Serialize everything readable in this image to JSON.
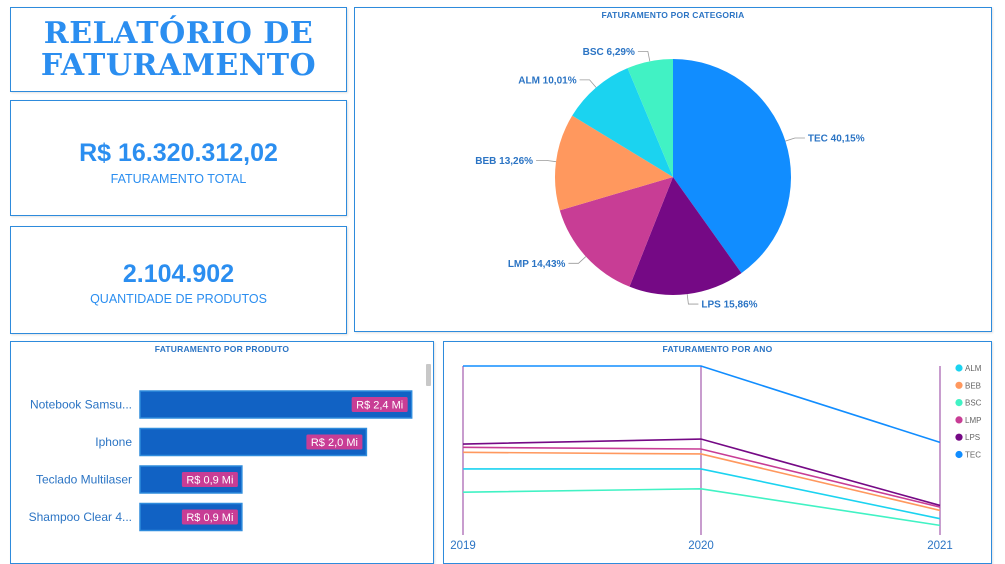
{
  "report": {
    "title_line1": "RELATÓRIO DE",
    "title_line2": "FATURAMENTO"
  },
  "kpis": {
    "revenue": {
      "value": "R$ 16.320.312,02",
      "label": "FATURAMENTO TOTAL"
    },
    "quantity": {
      "value": "2.104.902",
      "label": "QUANTIDADE DE PRODUTOS"
    }
  },
  "colors": {
    "TEC": "#118dff",
    "LPS": "#750985",
    "LMP": "#c83d95",
    "BEB": "#ff985e",
    "ALM": "#1bd3f0",
    "BSC": "#41f2c4",
    "bar": "#1162c4",
    "bar_label_bg": "#c83d95",
    "accent": "#2b8ef0"
  },
  "chart_data": [
    {
      "type": "pie",
      "title": "FATURAMENTO POR CATEGORIA",
      "slices": [
        {
          "name": "TEC",
          "value": 40.15,
          "label": "TEC 40,15%"
        },
        {
          "name": "LPS",
          "value": 15.86,
          "label": "LPS 15,86%"
        },
        {
          "name": "LMP",
          "value": 14.43,
          "label": "LMP 14,43%"
        },
        {
          "name": "BEB",
          "value": 13.26,
          "label": "BEB 13,26%"
        },
        {
          "name": "ALM",
          "value": 10.01,
          "label": "ALM 10,01%"
        },
        {
          "name": "BSC",
          "value": 6.29,
          "label": "BSC 6,29%"
        }
      ]
    },
    {
      "type": "bar",
      "orientation": "horizontal",
      "title": "FATURAMENTO POR PRODUTO",
      "categories": [
        "Notebook Samsu...",
        "Iphone",
        "Teclado Multilaser",
        "Shampoo Clear 4..."
      ],
      "values": [
        2.4,
        2.0,
        0.9,
        0.9
      ],
      "value_labels": [
        "R$ 2,4 Mi",
        "R$ 2,0 Mi",
        "R$ 0,9 Mi",
        "R$ 0,9 Mi"
      ],
      "xlim": [
        0,
        2.5
      ]
    },
    {
      "type": "line",
      "title": "FATURAMENTO POR ANO",
      "x": [
        "2019",
        "2020",
        "2021"
      ],
      "ylim": [
        0,
        100
      ],
      "legend": "right",
      "series": [
        {
          "name": "ALM",
          "values": [
            38,
            38,
            8
          ]
        },
        {
          "name": "BEB",
          "values": [
            48,
            47,
            13
          ]
        },
        {
          "name": "BSC",
          "values": [
            24,
            26,
            4
          ]
        },
        {
          "name": "LMP",
          "values": [
            51,
            50,
            15
          ]
        },
        {
          "name": "LPS",
          "values": [
            53,
            56,
            16
          ]
        },
        {
          "name": "TEC",
          "values": [
            100,
            100,
            54
          ]
        }
      ]
    }
  ]
}
